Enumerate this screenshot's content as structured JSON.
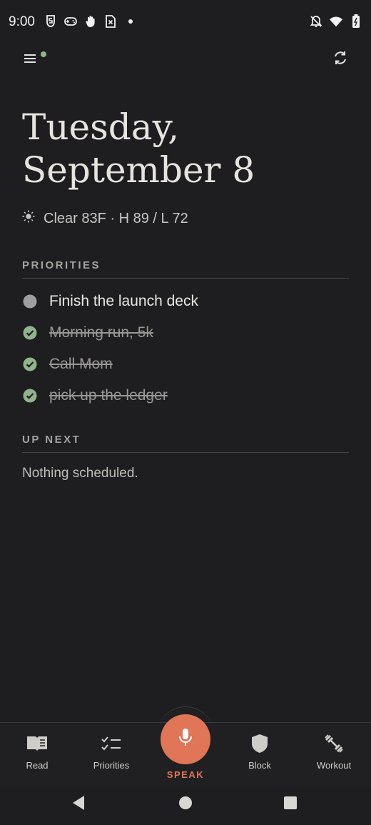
{
  "status_bar": {
    "time": "9:00",
    "left_icons": [
      "shield-s-icon",
      "gamepad-icon",
      "hand-icon",
      "sim-x-icon",
      "notification-dot-icon"
    ],
    "right_icons": [
      "bell-off-icon",
      "wifi-icon",
      "battery-icon"
    ]
  },
  "topbar": {
    "menu_icon": "hamburger-menu-icon",
    "indicator_color": "#8fb58c",
    "sync_icon": "sync-icon"
  },
  "header": {
    "day_line": "Tuesday,",
    "date_line": "September 8"
  },
  "weather": {
    "icon": "sun-icon",
    "text": "Clear 83F · H 89 / L 72"
  },
  "priorities": {
    "label": "PRIORITIES",
    "items": [
      {
        "text": "Finish the launch deck",
        "done": false
      },
      {
        "text": "Morning run, 5k",
        "done": true
      },
      {
        "text": "Call Mom",
        "done": true
      },
      {
        "text": "pick up the ledger",
        "done": true
      }
    ]
  },
  "up_next": {
    "label": "UP NEXT",
    "empty_text": "Nothing scheduled."
  },
  "bottom_nav": {
    "items": [
      {
        "label": "Read",
        "icon": "book-icon"
      },
      {
        "label": "Priorities",
        "icon": "checklist-icon"
      },
      {
        "label": "Block",
        "icon": "shield-icon"
      },
      {
        "label": "Workout",
        "icon": "dumbbell-icon"
      }
    ],
    "speak": {
      "label": "SPEAK",
      "icon": "microphone-icon"
    }
  },
  "colors": {
    "background": "#1e1e20",
    "accent": "#e07558",
    "check_green": "#8fb58c",
    "pending_circle": "#9e9ea3"
  },
  "system_nav": [
    "back-icon",
    "home-icon",
    "recents-icon"
  ]
}
